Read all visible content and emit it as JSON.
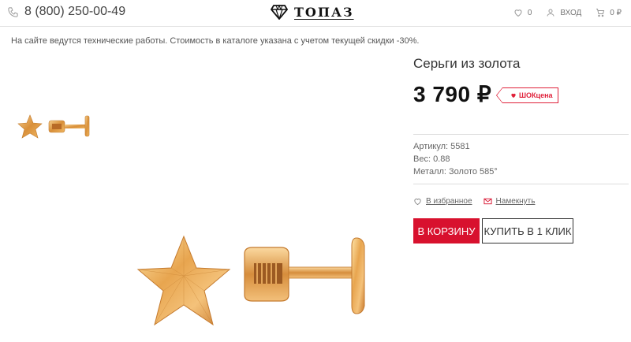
{
  "header": {
    "phone": "8 (800) 250-00-49",
    "logo_text": "ТОПАЗ",
    "favorites_count": "0",
    "login_label": "ВХОД",
    "cart_total": "0 ₽"
  },
  "notice": "На сайте ведутся технические работы. Стоимость в каталоге указана с учетом текущей скидки -30%.",
  "product": {
    "title": "Серьги из золота",
    "price": "3 790 ₽",
    "badge": "ШОКцена",
    "specs": {
      "article": "Артикул: 5581",
      "weight": "Вес: 0.88",
      "metal": "Металл: Золото 585°"
    }
  },
  "actions": {
    "favorite": "В избранное",
    "hint": "Намекнуть"
  },
  "buttons": {
    "cart": "В КОРЗИНУ",
    "one_click": "КУПИТЬ В 1 КЛИК"
  },
  "colors": {
    "accent": "#d8112e",
    "gold": "#e3a24c"
  }
}
